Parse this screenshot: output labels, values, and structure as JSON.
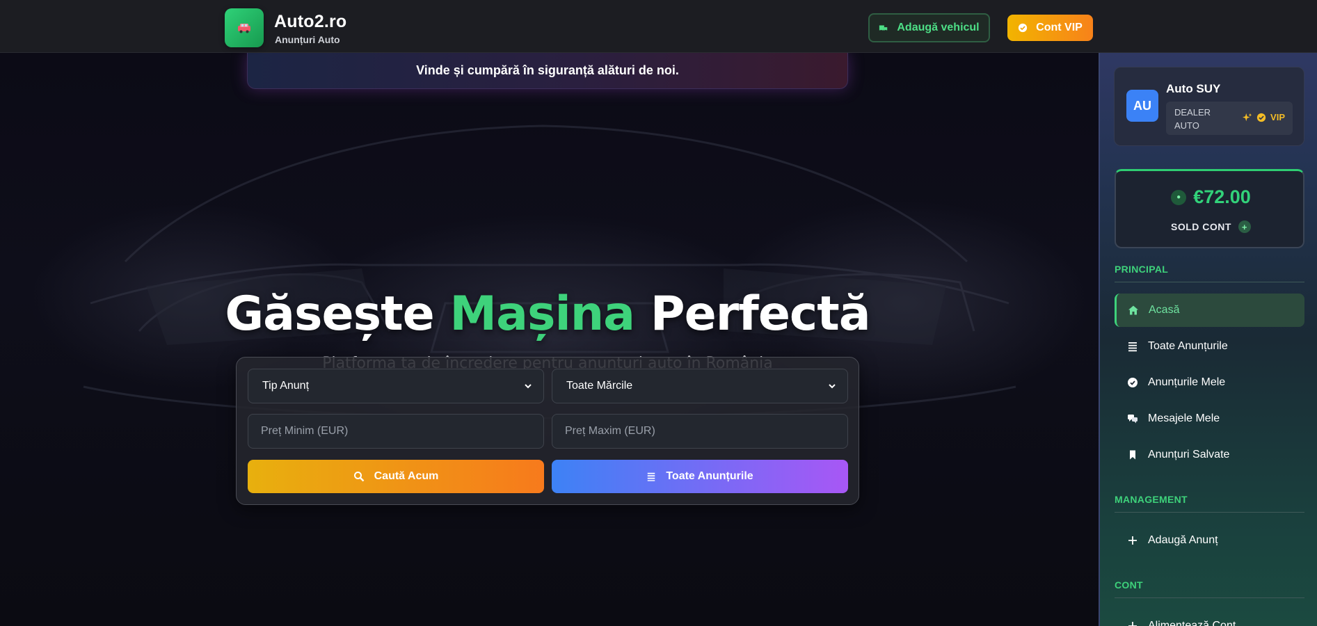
{
  "header": {
    "brand": "Auto2.ro",
    "brand_sub": "Anunțuri Auto",
    "add_vehicle_label": "Adaugă vehicul",
    "vip_label": "Cont VIP"
  },
  "banner": {
    "text": "Vinde și cumpără în siguranță alături de noi."
  },
  "hero": {
    "title_part1": "Găsește ",
    "title_accent": "Mașina",
    "title_part2": " Perfectă",
    "subtitle": "Platforma ta de încredere pentru anunțuri auto în România"
  },
  "search": {
    "type_select": "Tip Anunț",
    "brand_select": "Toate Mărcile",
    "min_price_placeholder": "Preț Minim (EUR)",
    "max_price_placeholder": "Preț Maxim (EUR)",
    "search_button": "Caută Acum",
    "all_button": "Toate Anunțurile"
  },
  "sidebar": {
    "user": {
      "initials": "AU",
      "name": "Auto SUY",
      "role": "DEALER AUTO",
      "badge": "VIP"
    },
    "balance": {
      "amount": "€72.00",
      "label": "SOLD CONT"
    },
    "sections": {
      "principal": "PRINCIPAL",
      "management": "MANAGEMENT",
      "cont": "CONT"
    },
    "items": [
      {
        "label": "Acasă",
        "icon": "home-icon"
      },
      {
        "label": "Toate Anunțurile",
        "icon": "list-icon"
      },
      {
        "label": "Anunțurile Mele",
        "icon": "check-badge-icon"
      },
      {
        "label": "Mesajele Mele",
        "icon": "chat-icon"
      },
      {
        "label": "Anunțuri Salvate",
        "icon": "bookmark-icon"
      },
      {
        "label": "Adaugă Anunț",
        "icon": "plus-icon"
      },
      {
        "label": "Alimentează Cont",
        "icon": "plus-icon"
      }
    ]
  },
  "colors": {
    "accent_green": "#3ed27b",
    "vip_orange": "#f7821a",
    "primary_blue": "#3b82f6",
    "purple": "#a857f5"
  }
}
